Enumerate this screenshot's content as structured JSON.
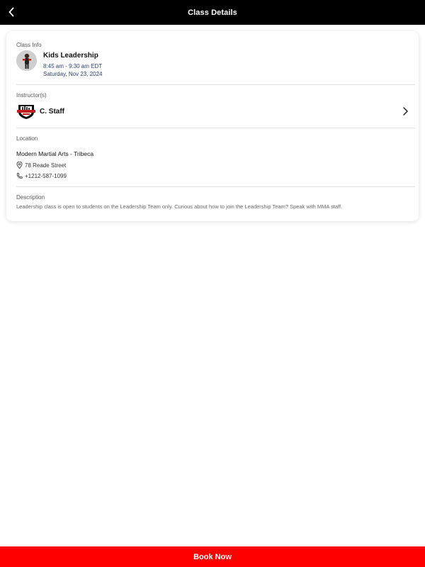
{
  "header": {
    "title": "Class Details",
    "back_icon": "chevron-left-icon"
  },
  "class_info": {
    "label": "Class Info",
    "name": "Kids Leadership",
    "time": "8:45 am - 9:30 am EDT",
    "date": "Saturday, Nov 23, 2024"
  },
  "instructors": {
    "label": "Instructor(s)",
    "name": "C. Staff",
    "chevron_icon": "chevron-right-icon"
  },
  "location": {
    "label": "Location",
    "name": "Modern Martial Arts - Tribeca",
    "address": "78 Reade Street",
    "phone": "+1212-587-1099",
    "address_icon": "map-pin-icon",
    "phone_icon": "phone-icon"
  },
  "description": {
    "label": "Description",
    "text": "Leadership class is open to students on the Leadership Team only. Curious about how to join the Leadership Team? Speak with MMA staff."
  },
  "footer": {
    "book_label": "Book Now"
  },
  "colors": {
    "topbar": "#000000",
    "book_button": "#ff0000",
    "secondary_text": "#2c3e6b"
  }
}
